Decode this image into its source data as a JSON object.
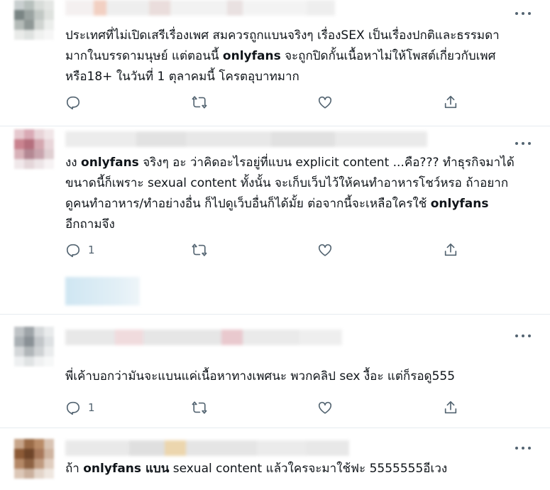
{
  "colors": {
    "text": "#0f1419",
    "muted": "#536471",
    "divider": "#e6ecf0"
  },
  "icons": [
    "reply-icon",
    "retweet-icon",
    "like-icon",
    "share-icon",
    "more-icon"
  ],
  "tweets": [
    {
      "lines": [
        [
          {
            "t": "ประเทศที่ไม่เปิดเสรีเรื่องเพศ สมควรถูกแบนจริงๆ เรื่องSEX เป็นเรื่องปกติและธรรมดา",
            "b": false
          }
        ],
        [
          {
            "t": "มากในบรรดามนุษย์ แต่ตอนนี้ ",
            "b": false
          },
          {
            "t": "onlyfans",
            "b": true
          },
          {
            "t": " จะถูกปิดกั้นเนื้อหาไม่ให้โพสต์เกี่ยวกับเพศ",
            "b": false
          }
        ],
        [
          {
            "t": "หรือ18+ ในวันที่ 1 ตุลาคมนี้ โครตอุบาทมาก",
            "b": false
          }
        ]
      ],
      "reply_count": ""
    },
    {
      "lines": [
        [
          {
            "t": "งง ",
            "b": false
          },
          {
            "t": "onlyfans",
            "b": true
          },
          {
            "t": " จริงๆ อะ ว่าคิดอะไรอยู่ที่แบน explicit content ...คือ??? ทำธุรกิจมาได้",
            "b": false
          }
        ],
        [
          {
            "t": "ขนาดนี้ก็เพราะ sexual content ทั้งนั้น จะเก็บเว็บไว้ให้คนทำอาหารโชว์หรอ ถ้าอยาก",
            "b": false
          }
        ],
        [
          {
            "t": "ดูคนทำอาหาร/ทำอย่างอื่น ก็ไปดูเว็บอื่นก็ได้มั้ย ต่อจากนี้จะเหลือใครใช้ ",
            "b": false
          },
          {
            "t": "onlyfans",
            "b": true
          }
        ],
        [
          {
            "t": "อีกถามจึง",
            "b": false
          }
        ]
      ],
      "reply_count": "1"
    },
    {
      "lines": [
        [
          {
            "t": "พี่เค้าบอกว่ามันจะแบนแค่เนื้อหาทางเพศนะ พวกคลิป sex งื้อะ แต่ก็รอดู555",
            "b": false
          }
        ]
      ],
      "reply_count": "1"
    },
    {
      "lines": [
        [
          {
            "t": "ถ้า ",
            "b": false
          },
          {
            "t": "onlyfans แบน",
            "b": true
          },
          {
            "t": " sexual content แล้วใครจะมาใช้ฟะ 5555555อีเวง",
            "b": false
          }
        ]
      ],
      "reply_count": ""
    }
  ]
}
